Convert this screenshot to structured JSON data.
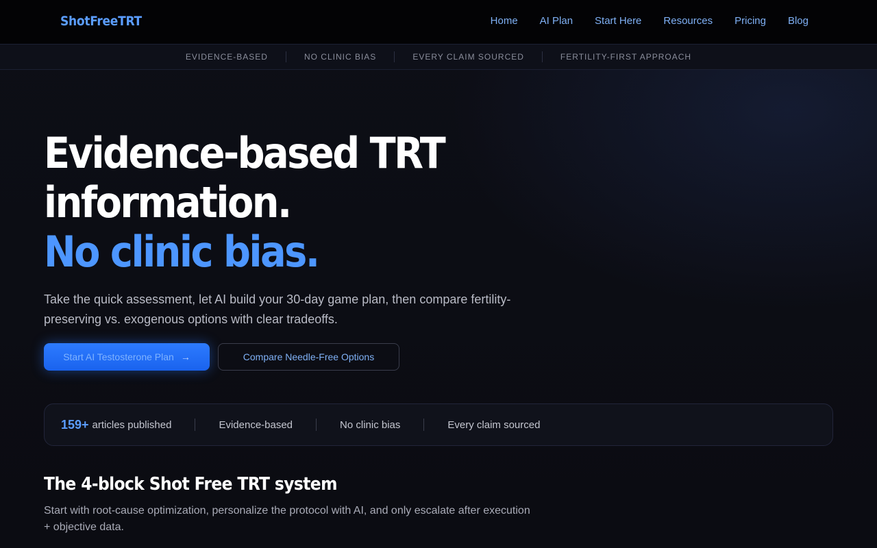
{
  "nav": {
    "brand": "ShotFreeTRT",
    "links": [
      "Home",
      "AI Plan",
      "Start Here",
      "Resources",
      "Pricing",
      "Blog"
    ]
  },
  "trust_strip": [
    "EVIDENCE-BASED",
    "NO CLINIC BIAS",
    "EVERY CLAIM SOURCED",
    "FERTILITY-FIRST APPROACH"
  ],
  "hero": {
    "title_line1": "Evidence-based TRT",
    "title_line2": "information.",
    "title_accent": "No clinic bias.",
    "subtitle": "Take the quick assessment, let AI build your 30-day game plan, then compare fertility-preserving vs. exogenous options with clear tradeoffs.",
    "primary_cta": "Start AI Testosterone Plan",
    "primary_cta_icon": "arrow-right-icon",
    "secondary_cta": "Compare Needle-Free Options"
  },
  "stats": {
    "count": "159+",
    "count_label": "articles published",
    "items": [
      "Evidence-based",
      "No clinic bias",
      "Every claim sourced"
    ]
  },
  "section": {
    "title": "The 4-block Shot Free TRT system",
    "subtitle": "Start with root-cause optimization, personalize the protocol with AI, and only escalate after execution + objective data."
  },
  "colors": {
    "accent": "#4d96ff",
    "primary_button": "#1f6bff",
    "background": "#0b0c12"
  }
}
